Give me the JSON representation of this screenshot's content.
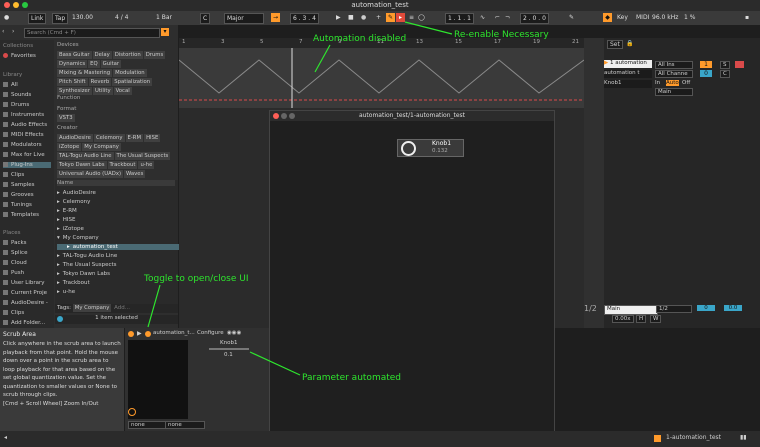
{
  "window": {
    "title": "automation_test"
  },
  "toolbar": {
    "link": "Link",
    "tap": "Tap",
    "tempo": "130.00",
    "signature": "4 / 4",
    "metro": "1 Bar",
    "key": "C",
    "scale": "Major",
    "position": "6 . 3 . 4",
    "loop_start": "1 . 1 . 1",
    "loop_len": "2 . 0 . 0",
    "key_btn": "Key",
    "midi": "MIDI",
    "sample_rate": "96.0 kHz",
    "cpu": "1 %"
  },
  "browser": {
    "search_placeholder": "Search (Cmd + F)",
    "collections": "Collections",
    "favorites": "Favorites",
    "library": "Library",
    "library_items": [
      "All",
      "Sounds",
      "Drums",
      "Instruments",
      "Audio Effects",
      "MIDI Effects",
      "Modulators",
      "Max for Live",
      "Plug-Ins",
      "Clips",
      "Samples",
      "Grooves",
      "Tunings",
      "Templates"
    ],
    "places": "Places",
    "places_items": [
      "Packs",
      "Splice",
      "Cloud",
      "Push",
      "User Library",
      "Current Proje",
      "AudioDesire -",
      "Clips",
      "Add Folder..."
    ],
    "devices_head": "Devices",
    "device_tags": [
      "Bass Guitar",
      "Delay",
      "Distortion",
      "Drums",
      "Dynamics",
      "EQ",
      "Guitar",
      "Mixing & Mastering",
      "Modulation",
      "Pitch Shift",
      "Reverb",
      "Spatialization",
      "Synthesizer",
      "Utility",
      "Vocal"
    ],
    "function_head": "Function",
    "format_head": "Format",
    "format_tags": [
      "VST3"
    ],
    "creator_head": "Creator",
    "creator_tags": [
      "AudioDesire",
      "Celemony",
      "E-RM",
      "HISE",
      "iZotope",
      "My Company",
      "TAL-Togu Audio Line",
      "The Usual Suspects",
      "Tokyo Dawn Labs",
      "Trackbout",
      "u-he",
      "Universal Audio (UADx)",
      "Waves"
    ],
    "name_head": "Name",
    "files": [
      "AudioDesire",
      "Celemony",
      "E-RM",
      "HISE",
      "iZotope",
      "My Company",
      "automation_test",
      "TAL-Togu Audio Line",
      "The Usual Suspects",
      "Tokyo Dawn Labs",
      "Trackbout",
      "u-he"
    ],
    "tags_label": "Tags:",
    "tags_value": "My Company",
    "tags_add": "Add...",
    "selection": "1 item selected"
  },
  "ruler": [
    "1",
    "3",
    "5",
    "7",
    "9",
    "11",
    "13",
    "15",
    "17",
    "19",
    "21"
  ],
  "mixer": {
    "set": "Set",
    "tracks": [
      "1 automation",
      "automation t",
      "Knob1"
    ],
    "all_ins": "All Ins",
    "all_channels": "All Channe",
    "in": "In",
    "auto": "Auto",
    "off": "Off",
    "main": "Main",
    "num1": "1",
    "s": "S",
    "c": "C",
    "zero": "0",
    "main_out": "Main",
    "half": "1/2",
    "half2": "1/2",
    "zero_a": "0",
    "zero_b": "0.0",
    "pct": "0.00x",
    "h": "H",
    "w": "W"
  },
  "plugin": {
    "title": "automation_test/1-automation_test",
    "knob_label": "Knob1",
    "knob_value": "0.132"
  },
  "device": {
    "name": "automation_t...",
    "configure": "Configure",
    "param_label": "Knob1",
    "param_value": "0.1",
    "none1": "none",
    "none2": "none"
  },
  "info": {
    "title": "Scrub Area",
    "text": "Click anywhere in the scrub area to launch playback from that point. Hold the mouse down over a point in the scrub area to loop playback for that area based on the set global quantization value. Set the quantization to smaller values or None to scrub through clips.",
    "shortcut": "[Cmd + Scroll Wheel] Zoom In/Out"
  },
  "status": {
    "track": "1-automation_test"
  },
  "annotations": {
    "auto_disabled": "Automation disabled",
    "reenable": "Re-enable Necessary",
    "toggle": "Toggle to open/close UI",
    "param_automated": "Parameter automated"
  },
  "colors": {
    "accent": "#ff9a2b",
    "annotation": "#2ee52e",
    "reenable": "#e24a3a"
  }
}
